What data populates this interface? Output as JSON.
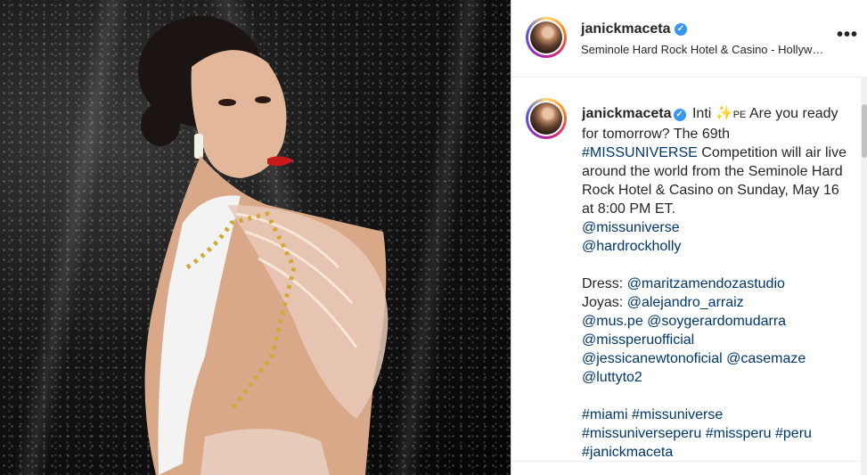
{
  "post": {
    "username": "janickmaceta",
    "location": "Seminole Hard Rock Hotel & Casino - Hollyw…"
  },
  "caption": {
    "username": "janickmaceta",
    "suffix": "Inti",
    "emoji": "✨",
    "country": "PE",
    "lines": [
      "Are you ready for tomorrow? The 69th",
      "#MISSUNIVERSE",
      "Competition will air live around the world from the Seminole Hard Rock Hotel & Casino on Sunday, May 16 at 8:00 PM ET.",
      "@missuniverse",
      "@hardrockholly"
    ],
    "dress_label": "Dress:",
    "dress_handle": "@maritzamendozastudio",
    "joyas_label": "Joyas:",
    "joyas_handle": "@alejandro_arraiz",
    "handles": [
      "@mus.pe",
      "@soygerardomudarra",
      "@missperuofficial",
      "@jessicanewtonoficial",
      "@casemaze",
      "@luttyto2"
    ],
    "hashtags": [
      "#miami",
      "#missuniverse",
      "#missuniverseperu",
      "#missperu",
      "#peru",
      "#janickmaceta"
    ]
  },
  "colors": {
    "link": "#00376b",
    "verified": "#3897f0",
    "text": "#262626"
  },
  "icons": {
    "verified": "verified-badge-icon",
    "more": "more-options-icon"
  }
}
